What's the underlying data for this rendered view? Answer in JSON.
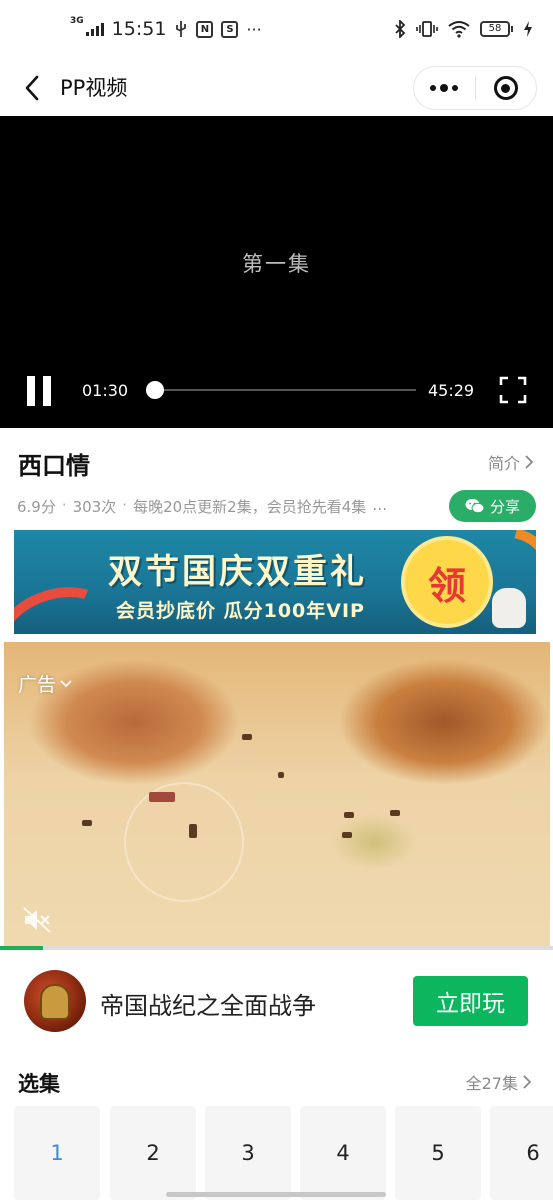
{
  "status_bar": {
    "time": "15:51",
    "network": "3G",
    "battery": "58",
    "left_icons": [
      "usb-icon",
      "nfc-icon",
      "notification-icon",
      "more-dots-icon"
    ],
    "right_icons": [
      "bluetooth-icon",
      "vibrate-icon",
      "wifi-icon",
      "battery-icon",
      "charging-icon"
    ]
  },
  "nav": {
    "title": "PP视频"
  },
  "player": {
    "overlay_text": "第一集",
    "current_time": "01:30",
    "total_time": "45:29",
    "progress": 0.033
  },
  "info": {
    "title": "西口情",
    "intro_label": "简介",
    "score": "6.9分",
    "plays": "303次",
    "update": "每晚20点更新2集，会员抢先看4集",
    "more": "…",
    "share_label": "分享"
  },
  "banner": {
    "title": "双节国庆双重礼",
    "subtitle": "会员抄底价  瓜分100年VIP",
    "badge": "领",
    "accent_color": "#1f87a6"
  },
  "ad": {
    "label": "广告",
    "progress": 0.077,
    "app_name": "帝国战纪之全面战争",
    "play_label": "立即玩",
    "play_color": "#0bb65f"
  },
  "episodes": {
    "title": "选集",
    "all_label": "全27集",
    "items": [
      "1",
      "2",
      "3",
      "4",
      "5",
      "6"
    ],
    "active_index": 0
  }
}
